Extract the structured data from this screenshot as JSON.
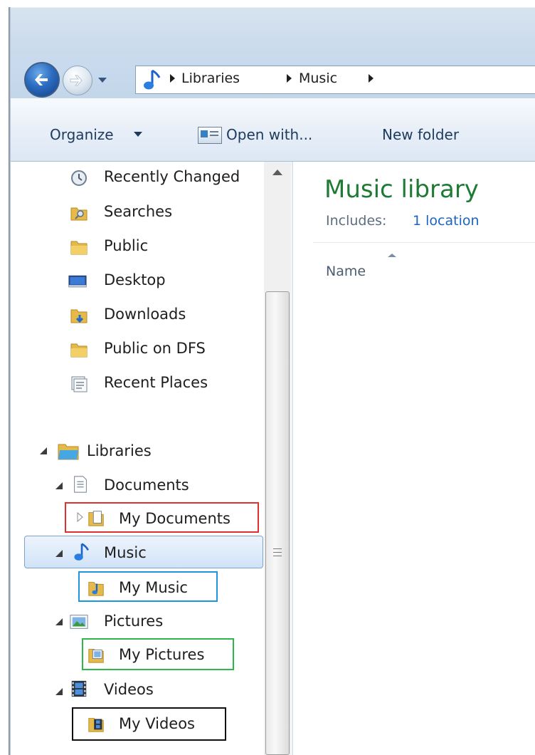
{
  "address_bar": {
    "crumbs": [
      "Libraries",
      "Music"
    ]
  },
  "toolbar": {
    "organize_label": "Organize",
    "open_with_label": "Open with...",
    "new_folder_label": "New folder"
  },
  "nav_pane": {
    "favorites": [
      {
        "label": "Recently Changed",
        "icon": "recently-changed-icon"
      },
      {
        "label": "Searches",
        "icon": "searches-folder-icon"
      },
      {
        "label": "Public",
        "icon": "folder-icon"
      },
      {
        "label": "Desktop",
        "icon": "desktop-icon"
      },
      {
        "label": "Downloads",
        "icon": "downloads-folder-icon"
      },
      {
        "label": "Public on DFS",
        "icon": "folder-icon"
      },
      {
        "label": "Recent Places",
        "icon": "recent-places-icon"
      }
    ],
    "libraries": {
      "label": "Libraries",
      "icon": "libraries-icon",
      "children": [
        {
          "label": "Documents",
          "icon": "documents-library-icon",
          "expanded": true,
          "children": [
            {
              "label": "My Documents",
              "icon": "document-folder-icon",
              "expander": "collapsed",
              "highlight_color": "#e03030"
            }
          ]
        },
        {
          "label": "Music",
          "icon": "music-note-icon",
          "expanded": true,
          "selected": true,
          "children": [
            {
              "label": "My Music",
              "icon": "music-folder-icon",
              "highlight_color": "#1f97e0"
            }
          ]
        },
        {
          "label": "Pictures",
          "icon": "picture-library-icon",
          "expanded": true,
          "children": [
            {
              "label": "My Pictures",
              "icon": "picture-folder-icon",
              "highlight_color": "#2eb84b"
            }
          ]
        },
        {
          "label": "Videos",
          "icon": "film-icon",
          "expanded": true,
          "children": [
            {
              "label": "My Videos",
              "icon": "video-folder-icon",
              "highlight_color": "#101010"
            }
          ]
        }
      ]
    }
  },
  "content": {
    "library_title": "Music library",
    "includes_label": "Includes:",
    "location_link": "1 location",
    "column_name": "Name"
  },
  "colors": {
    "library_title_green": "#1e7a34",
    "link_blue": "#1b64c4",
    "selection_border": "#7da2ce"
  }
}
